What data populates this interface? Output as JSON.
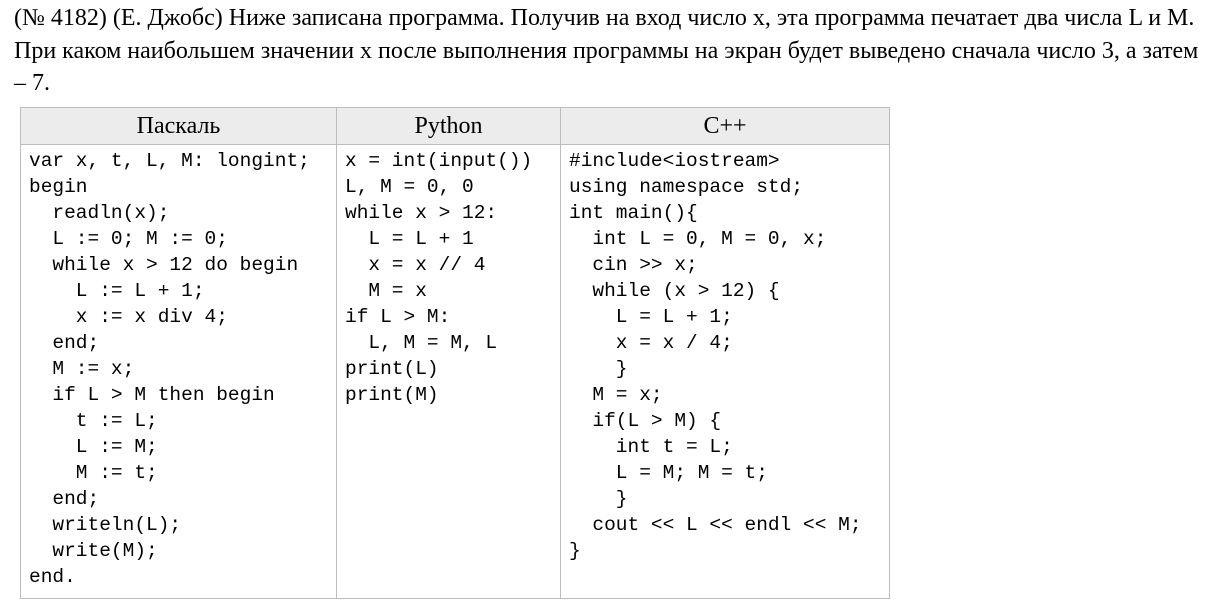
{
  "problem": {
    "text": "(№ 4182) (Е. Джобс) Ниже записана программа. Получив на вход число x, эта программа печатает два числа L и M. При каком наибольшем значении x после выполнения программы на экран будет выведено сначала число 3, а затем – 7."
  },
  "table": {
    "headers": [
      "Паскаль",
      "Python",
      "C++"
    ],
    "pascal": [
      "var x, t, L, M: longint;",
      "begin",
      "  readln(x);",
      "  L := 0; M := 0;",
      "  while x > 12 do begin",
      "    L := L + 1;",
      "    x := x div 4;",
      "  end;",
      "  M := x;",
      "  if L > M then begin",
      "    t := L;",
      "    L := M;",
      "    M := t;",
      "  end;",
      "  writeln(L);",
      "  write(M);",
      "end."
    ],
    "python": [
      "x = int(input())",
      "L, M = 0, 0",
      "while x > 12:",
      "  L = L + 1",
      "  x = x // 4",
      "  M = x",
      "if L > M:",
      "  L, M = M, L",
      "print(L)",
      "print(M)"
    ],
    "cpp": [
      "#include<iostream>",
      "using namespace std;",
      "int main(){",
      "  int L = 0, M = 0, x;",
      "  cin >> x;",
      "  while (x > 12) {",
      "    L = L + 1;",
      "    x = x / 4;",
      "    }",
      "  M = x;",
      "  if(L > M) {",
      "    int t = L;",
      "    L = M; M = t;",
      "    }",
      "  cout << L << endl << M;",
      "}"
    ]
  }
}
